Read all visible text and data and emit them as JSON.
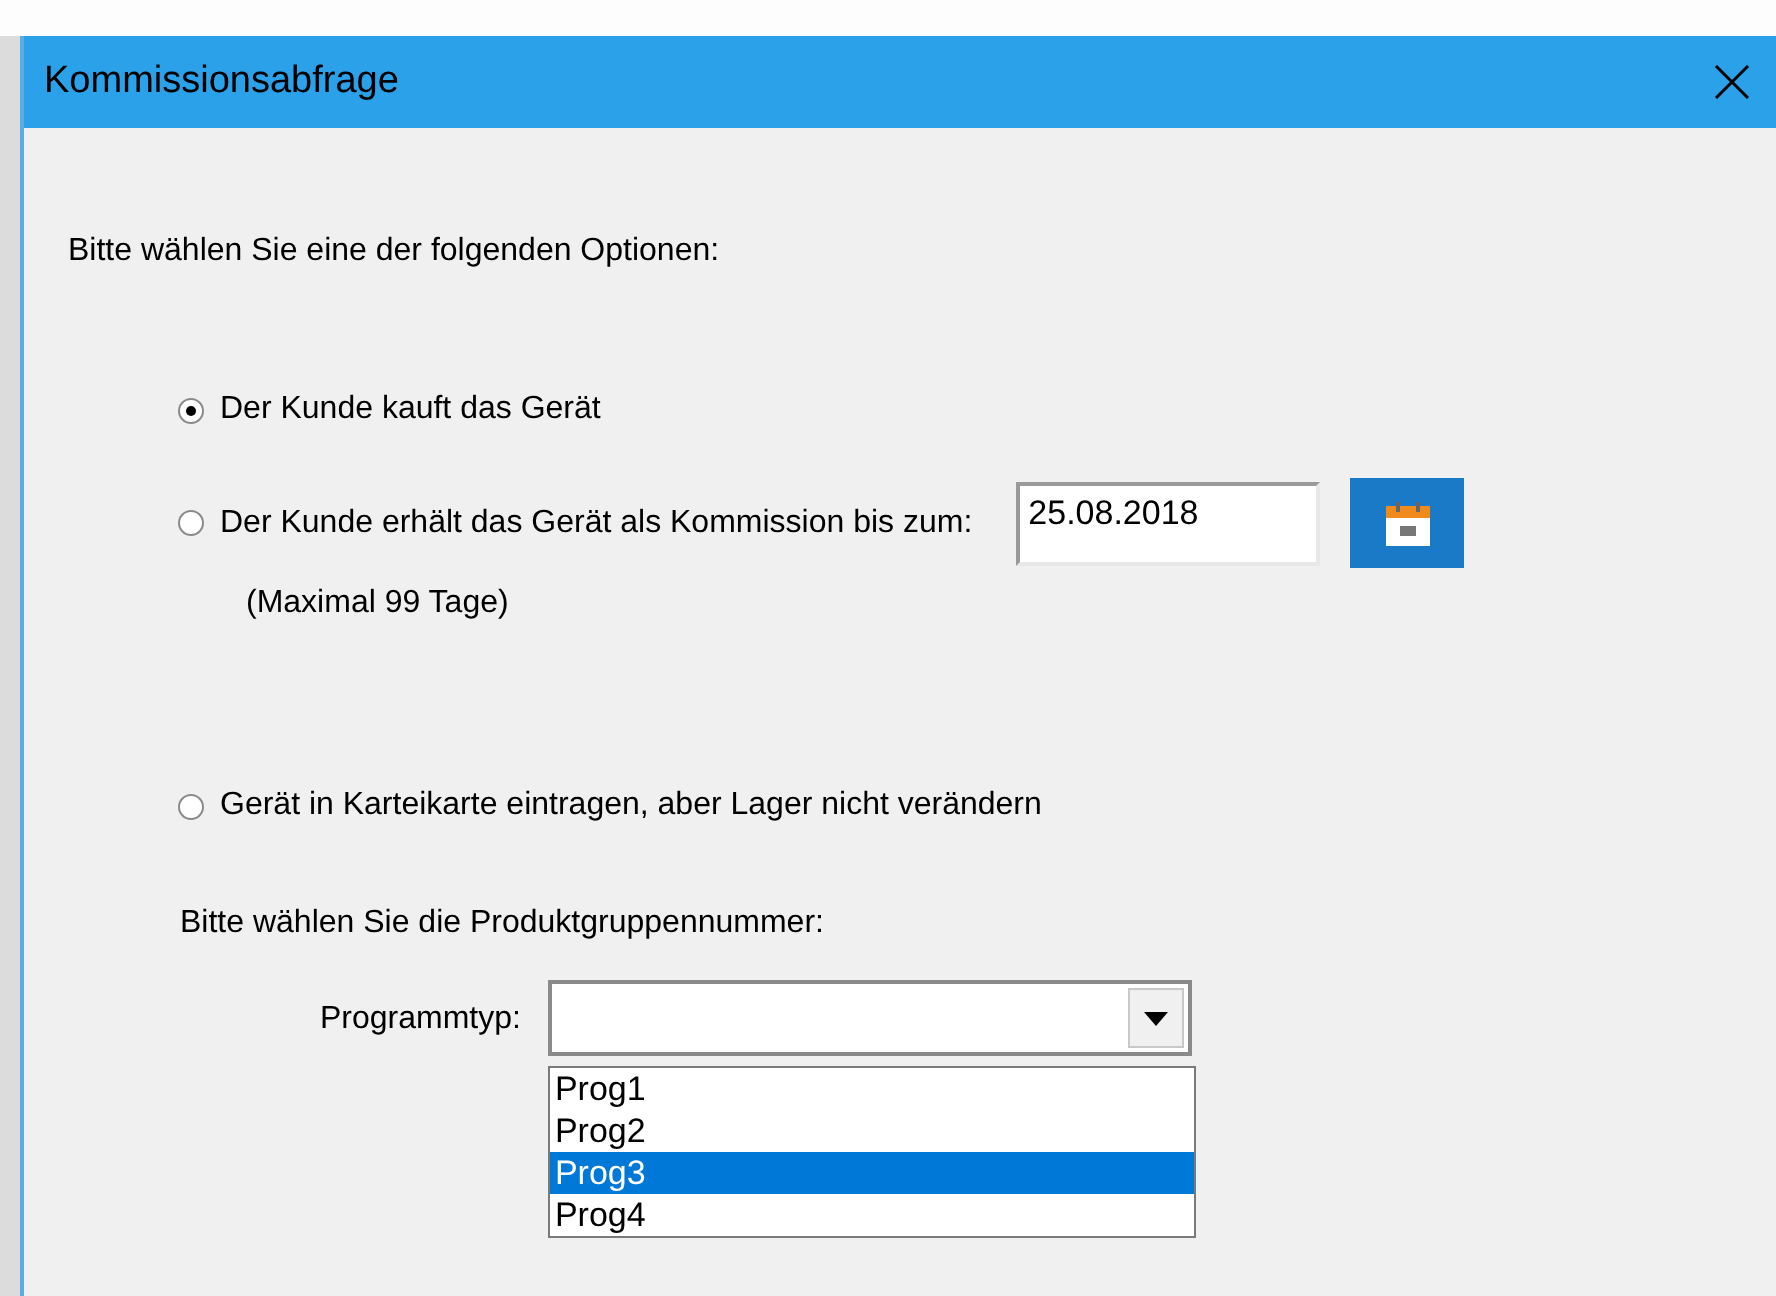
{
  "window": {
    "title": "Kommissionsabfrage"
  },
  "prompt": "Bitte wählen Sie eine der folgenden Optionen:",
  "options": [
    {
      "label": "Der Kunde kauft das Gerät",
      "selected": true
    },
    {
      "label": "Der Kunde erhält das Gerät als Kommission bis zum:",
      "selected": false
    },
    {
      "label": "Gerät in Karteikarte eintragen, aber Lager nicht verändern",
      "selected": false
    }
  ],
  "date_field": {
    "value": "25.08.2018"
  },
  "hint": "(Maximal 99 Tage)",
  "group_prompt": "Bitte wählen Sie die Produktgruppennummer:",
  "combo": {
    "label": "Programmtyp:",
    "expanded": true,
    "items": [
      {
        "label": "Prog1",
        "selected": false
      },
      {
        "label": "Prog2",
        "selected": false
      },
      {
        "label": "Prog3",
        "selected": true
      },
      {
        "label": "Prog4",
        "selected": false
      }
    ]
  }
}
